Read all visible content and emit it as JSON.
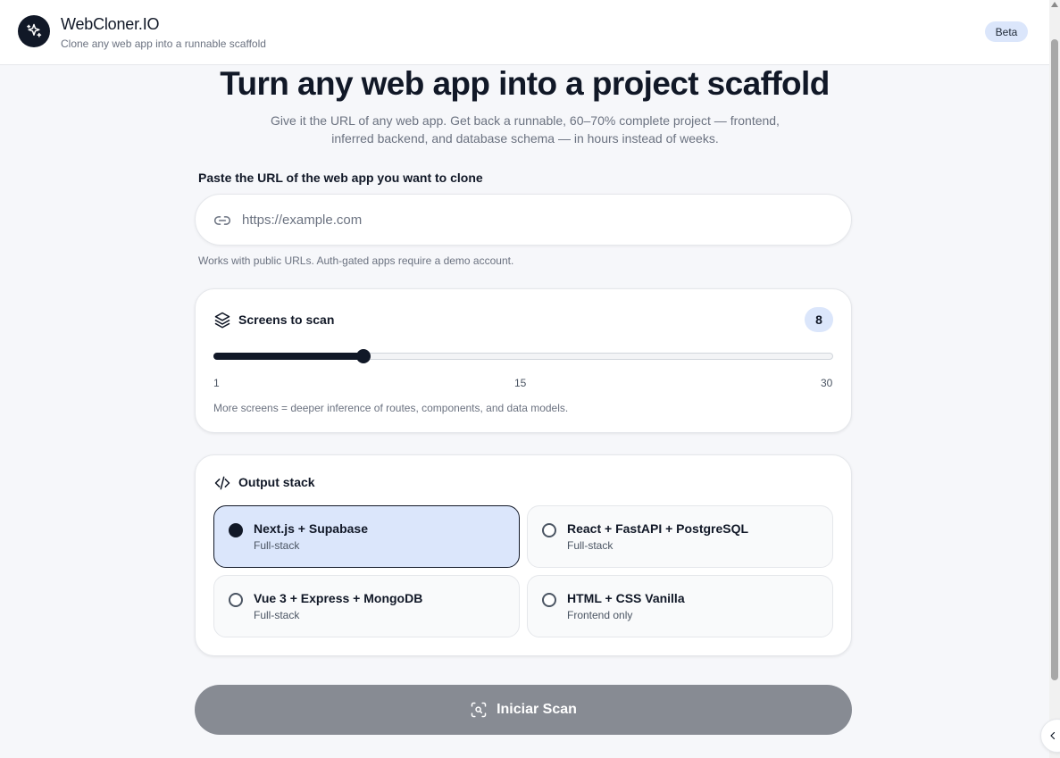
{
  "header": {
    "title": "WebCloner.IO",
    "subtitle": "Clone any web app into a runnable scaffold",
    "badge": "Beta"
  },
  "hero": {
    "title": "Turn any web app into a project scaffold",
    "description": "Give it the URL of any web app. Get back a runnable, 60–70% complete project — frontend, inferred backend, and database schema — in hours instead of weeks."
  },
  "url_section": {
    "label": "Paste the URL of the web app you want to clone",
    "placeholder": "https://example.com",
    "value": "",
    "hint": "Works with public URLs. Auth-gated apps require a demo account."
  },
  "screens": {
    "title": "Screens to scan",
    "value": "8",
    "min": "1",
    "mid": "15",
    "max": "30",
    "hint": "More screens = deeper inference of routes, components, and data models."
  },
  "stack": {
    "title": "Output stack",
    "options": [
      {
        "title": "Next.js + Supabase",
        "subtitle": "Full-stack",
        "selected": true
      },
      {
        "title": "React + FastAPI + PostgreSQL",
        "subtitle": "Full-stack",
        "selected": false
      },
      {
        "title": "Vue 3 + Express + MongoDB",
        "subtitle": "Full-stack",
        "selected": false
      },
      {
        "title": "HTML + CSS Vanilla",
        "subtitle": "Frontend only",
        "selected": false
      }
    ]
  },
  "action": {
    "scan_label": "Iniciar Scan"
  },
  "icons": {
    "logo": "sparkles-icon",
    "url": "link-icon",
    "screens": "layers-icon",
    "stack": "code-icon",
    "scan": "scan-icon",
    "collapse": "chevron-left-icon"
  },
  "colors": {
    "primary": "#111827",
    "selected_bg": "#dbe6fb",
    "button_disabled": "#878b93"
  }
}
